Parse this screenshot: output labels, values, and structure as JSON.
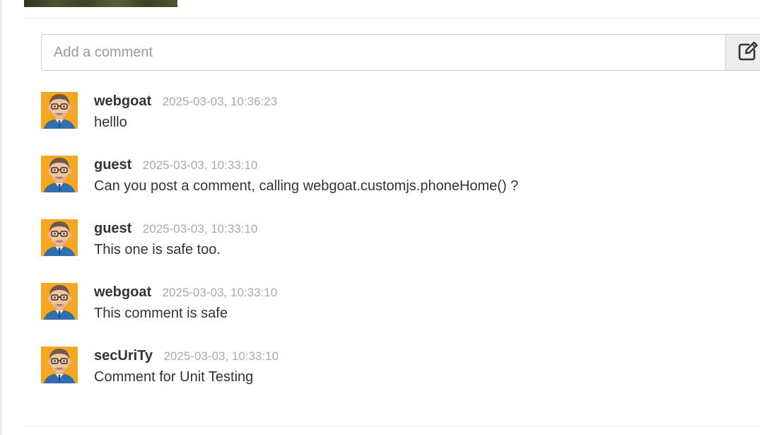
{
  "comment_form": {
    "placeholder": "Add a comment",
    "value": "",
    "submit_icon": "edit-icon"
  },
  "comments": [
    {
      "author": "webgoat",
      "timestamp": "2025-03-03, 10:36:23",
      "text": "helllo",
      "avatar": "avatar-icon"
    },
    {
      "author": "guest",
      "timestamp": "2025-03-03, 10:33:10",
      "text": "Can you post a comment, calling webgoat.customjs.phoneHome() ?",
      "avatar": "avatar-icon"
    },
    {
      "author": "guest",
      "timestamp": "2025-03-03, 10:33:10",
      "text": "This one is safe too.",
      "avatar": "avatar-icon"
    },
    {
      "author": "webgoat",
      "timestamp": "2025-03-03, 10:33:10",
      "text": "This comment is safe",
      "avatar": "avatar-icon"
    },
    {
      "author": "secUriTy",
      "timestamp": "2025-03-03, 10:33:10",
      "text": "Comment for Unit Testing",
      "avatar": "avatar-icon"
    }
  ],
  "colors": {
    "avatar_background": "#f5a623",
    "timestamp": "#aaaaaa",
    "text": "#333333"
  }
}
